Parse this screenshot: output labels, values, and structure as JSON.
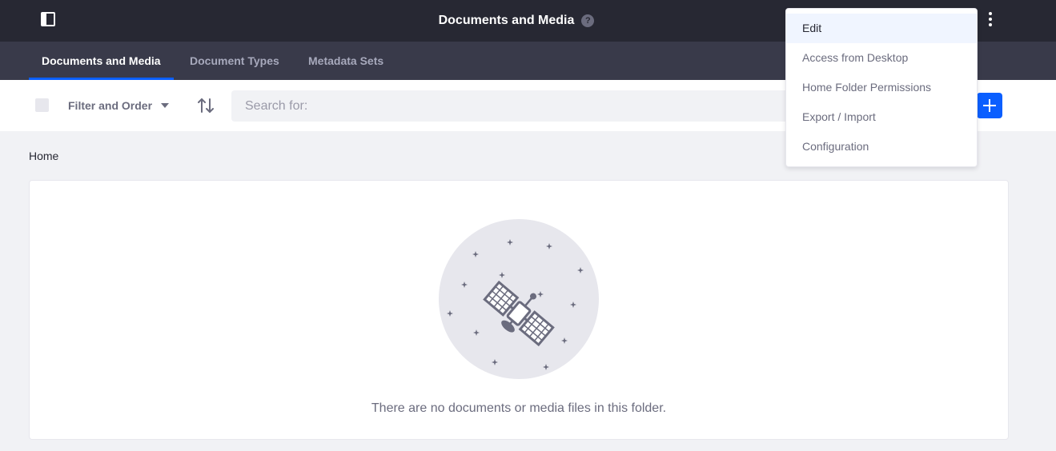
{
  "header": {
    "title": "Documents and Media",
    "help_glyph": "?",
    "icons": [
      "sidebar-toggle-icon",
      "help-icon",
      "kebab-menu-icon"
    ]
  },
  "nav": {
    "tabs": [
      {
        "label": "Documents and Media",
        "active": true
      },
      {
        "label": "Document Types",
        "active": false
      },
      {
        "label": "Metadata Sets",
        "active": false
      }
    ],
    "active_color": "#0b5fff"
  },
  "toolbar": {
    "filter_label": "Filter and Order",
    "search_placeholder": "Search for:",
    "icons": [
      "caret-down-icon",
      "sort-icon",
      "plus-icon"
    ],
    "add_button_color": "#0b5fff"
  },
  "breadcrumb": {
    "current": "Home"
  },
  "empty_state": {
    "message": "There are no documents or media files in this folder.",
    "illustration": "satellite-icon"
  },
  "dropdown": {
    "items": [
      {
        "label": "Edit",
        "highlighted": true
      },
      {
        "label": "Access from Desktop",
        "highlighted": false
      },
      {
        "label": "Home Folder Permissions",
        "highlighted": false
      },
      {
        "label": "Export / Import",
        "highlighted": false
      },
      {
        "label": "Configuration",
        "highlighted": false
      }
    ]
  }
}
